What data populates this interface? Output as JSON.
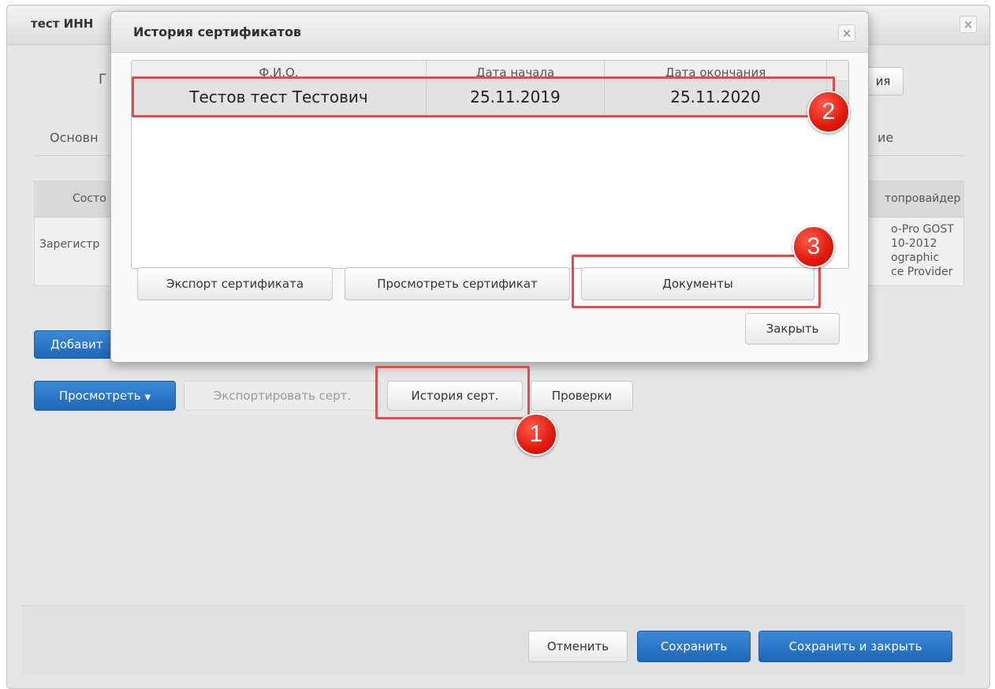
{
  "window": {
    "title": "тест ИНН",
    "close_label": "×",
    "tab_partial_left": "Основн",
    "tab_partial_right": "ие",
    "top_partial_button": "ия",
    "top_partial_letter": "Г"
  },
  "background_table": {
    "header_left": "Состо",
    "header_right": "топровайдер",
    "row_left": "Зарегистр",
    "row_right": [
      "o-Pro GOST",
      "10-2012",
      "ographic",
      "ce Provider"
    ]
  },
  "toolbar": {
    "add_label": "Добавит",
    "view_label": "Просмотреть",
    "export_label": "Экспортировать серт.",
    "history_label": "История серт.",
    "checks_label": "Проверки"
  },
  "footer": {
    "cancel_label": "Отменить",
    "save_label": "Сохранить",
    "save_close_label": "Сохранить и закрыть"
  },
  "modal": {
    "title": "История сертификатов",
    "close_label": "×",
    "columns": [
      "Ф.И.О.",
      "Дата начала",
      "Дата окончания"
    ],
    "rows": [
      {
        "name": "Тестов тест Тестович",
        "start": "25.11.2019",
        "end": "25.11.2020"
      }
    ],
    "export_cert_label": "Экспорт сертификата",
    "view_cert_label": "Просмотреть сертификат",
    "documents_label": "Документы",
    "close_button_label": "Закрыть"
  },
  "annotations": {
    "badge1": "1",
    "badge2": "2",
    "badge3": "3",
    "highlight_color": "#e64a4a",
    "badge_color": "#e0190d"
  },
  "colors": {
    "primary": "#1f66b8"
  }
}
